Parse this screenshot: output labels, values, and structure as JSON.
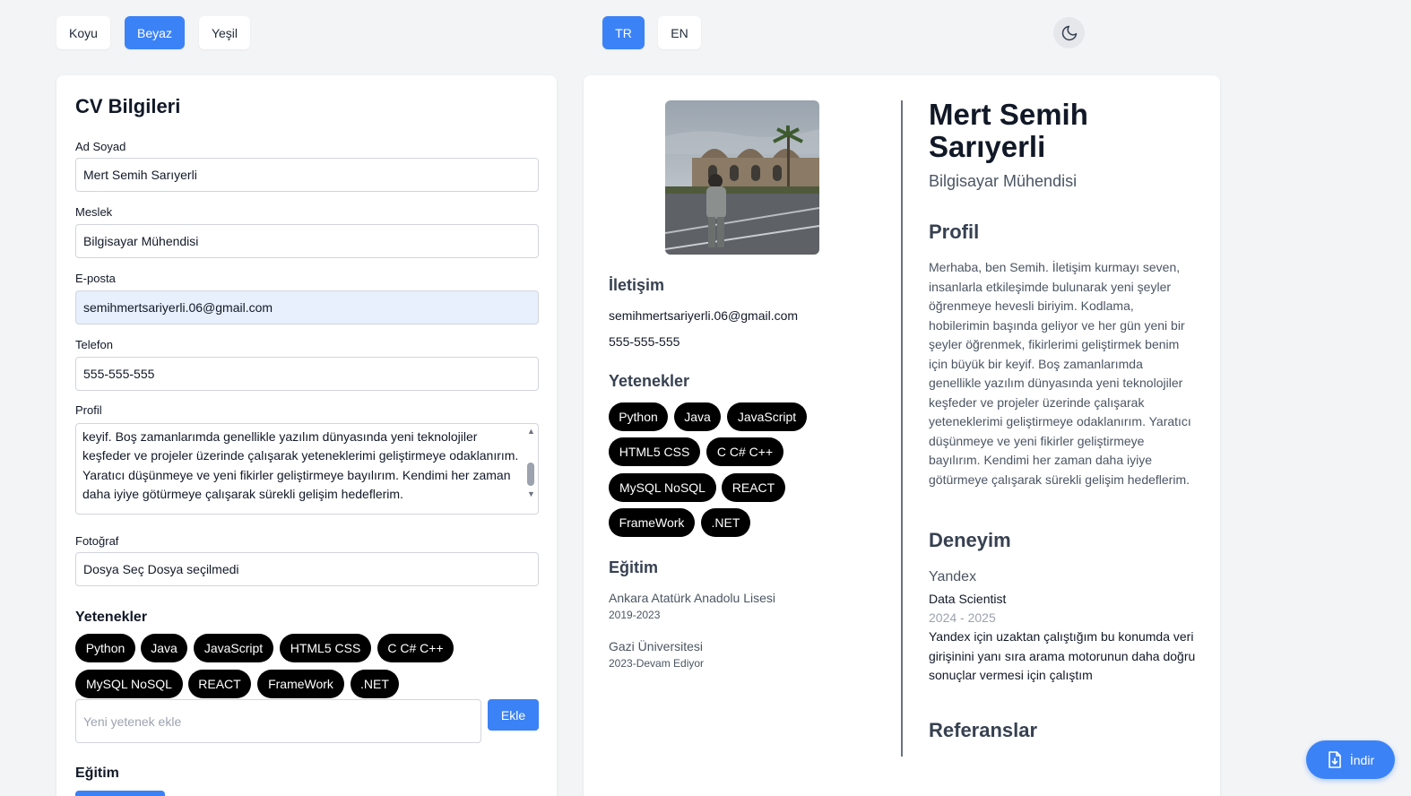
{
  "theme_buttons": [
    {
      "label": "Koyu",
      "active": false
    },
    {
      "label": "Beyaz",
      "active": true
    },
    {
      "label": "Yeşil",
      "active": false
    }
  ],
  "lang_buttons": [
    {
      "label": "TR",
      "active": true
    },
    {
      "label": "EN",
      "active": false
    }
  ],
  "dark_mode_icon": "moon-icon",
  "form": {
    "title": "CV Bilgileri",
    "name_label": "Ad Soyad",
    "name_value": "Mert Semih Sarıyerli",
    "job_label": "Meslek",
    "job_value": "Bilgisayar Mühendisi",
    "email_label": "E-posta",
    "email_value": "semihmertsariyerli.06@gmail.com",
    "phone_label": "Telefon",
    "phone_value": "555-555-555",
    "profile_label": "Profil",
    "profile_value": "Merhaba, ben Semih. İletişim kurmayı seven, insanlarla etkileşimde bulunarak yeni şeyler öğrenmeye hevesli biriyim. Kodlama, hobilerimin başında geliyor ve her gün yeni bir şeyler öğrenmek, fikirlerimi geliştirmek benim için büyük bir keyif. Boş zamanlarımda genellikle yazılım dünyasında yeni teknolojiler keşfeder ve projeler üzerinde çalışarak yeteneklerimi geliştirmeye odaklanırım. Yaratıcı düşünmeye ve yeni fikirler geliştirmeye bayılırım. Kendimi her zaman daha iyiye götürmeye çalışarak sürekli gelişim hedeflerim.",
    "photo_label": "Fotoğraf",
    "photo_value": "Dosya Seç Dosya seçilmedi",
    "skills_title": "Yetenekler",
    "skills": [
      "Python",
      "Java",
      "JavaScript",
      "HTML5 CSS",
      "C C# C++",
      "MySQL NoSQL",
      "REACT",
      "FrameWork",
      ".NET"
    ],
    "new_skill_placeholder": "Yeni yetenek ekle",
    "add_button": "Ekle",
    "education_title": "Eğitim"
  },
  "cv": {
    "photo_alt": "profile-photo",
    "contact_title": "İletişim",
    "email": "semihmertsariyerli.06@gmail.com",
    "phone": "555-555-555",
    "skills_title": "Yetenekler",
    "skills": [
      "Python",
      "Java",
      "JavaScript",
      "HTML5 CSS",
      "C C# C++",
      "MySQL NoSQL",
      "REACT",
      "FrameWork",
      ".NET"
    ],
    "education_title": "Eğitim",
    "education": [
      {
        "school": "Ankara Atatürk Anadolu Lisesi",
        "years": "2019-2023"
      },
      {
        "school": "Gazi Üniversitesi",
        "years": "2023-Devam Ediyor"
      }
    ],
    "name": "Mert Semih Sarıyerli",
    "job": "Bilgisayar Mühendisi",
    "profile_title": "Profil",
    "profile": "Merhaba, ben Semih. İletişim kurmayı seven, insanlarla etkileşimde bulunarak yeni şeyler öğrenmeye hevesli biriyim. Kodlama, hobilerimin başında geliyor ve her gün yeni bir şeyler öğrenmek, fikirlerimi geliştirmek benim için büyük bir keyif. Boş zamanlarımda genellikle yazılım dünyasında yeni teknolojiler keşfeder ve projeler üzerinde çalışarak yeteneklerimi geliştirmeye odaklanırım. Yaratıcı düşünmeye ve yeni fikirler geliştirmeye bayılırım. Kendimi her zaman daha iyiye götürmeye çalışarak sürekli gelişim hedeflerim.",
    "experience_title": "Deneyim",
    "experience": {
      "company": "Yandex",
      "role": "Data Scientist",
      "years": "2024 - 2025",
      "description": "Yandex için uzaktan çalıştığım bu konumda veri girişinini yanı sıra arama motorunun daha doğru sonuçlar vermesi için çalıştım"
    },
    "references_title": "Referanslar"
  },
  "download_button": "İndir",
  "colors": {
    "accent": "#3b82f6",
    "chip": "#000000",
    "background": "#f3f4f6"
  }
}
